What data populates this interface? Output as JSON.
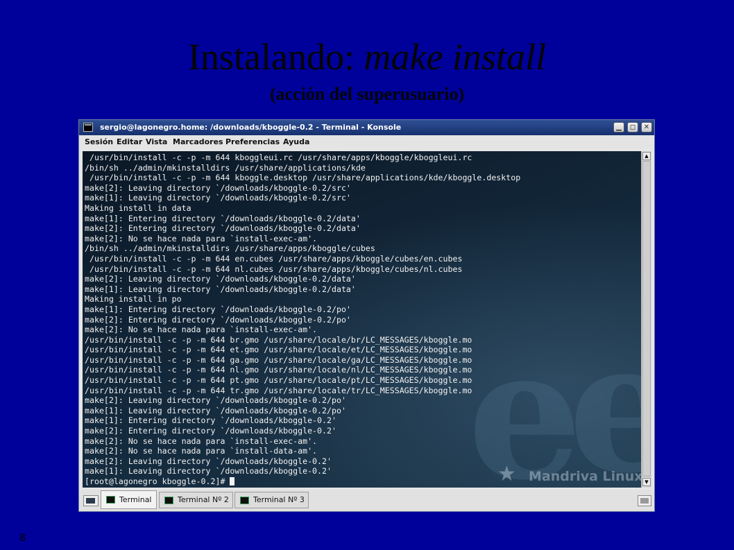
{
  "slide": {
    "title_main": "Instalando: ",
    "title_emphasis": "make install",
    "subtitle": "(acción del superusuario)",
    "page_number": "8"
  },
  "window": {
    "title": "sergio@lagonegro.home: /downloads/kboggle-0.2 - Terminal - Konsole",
    "buttons": [
      "minimize",
      "maximize",
      "close"
    ]
  },
  "menu": [
    "Sesión",
    "Editar",
    "Vista",
    "Marcadores",
    "Preferencias",
    "Ayuda"
  ],
  "terminal": {
    "lines": [
      " /usr/bin/install -c -p -m 644 kboggleui.rc /usr/share/apps/kboggle/kboggleui.rc",
      "/bin/sh ../admin/mkinstalldirs /usr/share/applications/kde",
      " /usr/bin/install -c -p -m 644 kboggle.desktop /usr/share/applications/kde/kboggle.desktop",
      "make[2]: Leaving directory `/downloads/kboggle-0.2/src'",
      "make[1]: Leaving directory `/downloads/kboggle-0.2/src'",
      "Making install in data",
      "make[1]: Entering directory `/downloads/kboggle-0.2/data'",
      "make[2]: Entering directory `/downloads/kboggle-0.2/data'",
      "make[2]: No se hace nada para `install-exec-am'.",
      "/bin/sh ../admin/mkinstalldirs /usr/share/apps/kboggle/cubes",
      " /usr/bin/install -c -p -m 644 en.cubes /usr/share/apps/kboggle/cubes/en.cubes",
      " /usr/bin/install -c -p -m 644 nl.cubes /usr/share/apps/kboggle/cubes/nl.cubes",
      "make[2]: Leaving directory `/downloads/kboggle-0.2/data'",
      "make[1]: Leaving directory `/downloads/kboggle-0.2/data'",
      "Making install in po",
      "make[1]: Entering directory `/downloads/kboggle-0.2/po'",
      "make[2]: Entering directory `/downloads/kboggle-0.2/po'",
      "make[2]: No se hace nada para `install-exec-am'.",
      "/usr/bin/install -c -p -m 644 br.gmo /usr/share/locale/br/LC_MESSAGES/kboggle.mo",
      "/usr/bin/install -c -p -m 644 et.gmo /usr/share/locale/et/LC_MESSAGES/kboggle.mo",
      "/usr/bin/install -c -p -m 644 ga.gmo /usr/share/locale/ga/LC_MESSAGES/kboggle.mo",
      "/usr/bin/install -c -p -m 644 nl.gmo /usr/share/locale/nl/LC_MESSAGES/kboggle.mo",
      "/usr/bin/install -c -p -m 644 pt.gmo /usr/share/locale/pt/LC_MESSAGES/kboggle.mo",
      "/usr/bin/install -c -p -m 644 tr.gmo /usr/share/locale/tr/LC_MESSAGES/kboggle.mo",
      "make[2]: Leaving directory `/downloads/kboggle-0.2/po'",
      "make[1]: Leaving directory `/downloads/kboggle-0.2/po'",
      "make[1]: Entering directory `/downloads/kboggle-0.2'",
      "make[2]: Entering directory `/downloads/kboggle-0.2'",
      "make[2]: No se hace nada para `install-exec-am'.",
      "make[2]: No se hace nada para `install-data-am'.",
      "make[2]: Leaving directory `/downloads/kboggle-0.2'",
      "make[1]: Leaving directory `/downloads/kboggle-0.2'"
    ],
    "prompt": "[root@lagonegro kboggle-0.2]# ",
    "background_logo": "Mandriva Linux"
  },
  "tabs": [
    {
      "label": "Terminal",
      "active": true
    },
    {
      "label": "Terminal Nº 2",
      "active": false
    },
    {
      "label": "Terminal Nº 3",
      "active": false
    }
  ],
  "colors": {
    "slide_background": "#00009a",
    "titlebar": "#1f3d82",
    "terminal_background": "#13283b",
    "terminal_text": "#f2f2f2"
  }
}
